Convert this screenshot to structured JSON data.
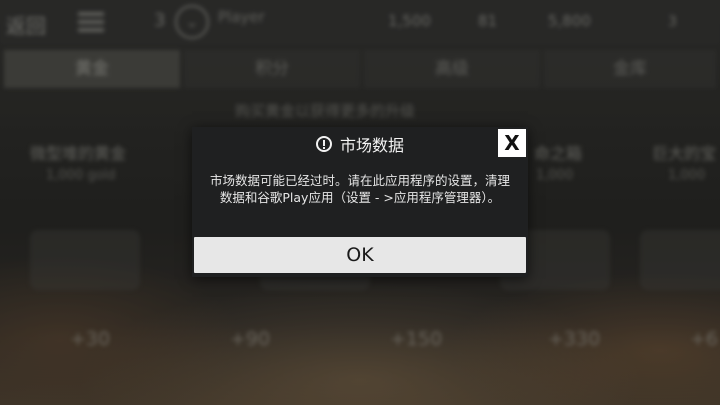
{
  "background": {
    "topbar": {
      "back_label": "返回",
      "level": "3",
      "badge_icon": "rank-badge-icon",
      "player_name": "Player",
      "stat_1": "1,500",
      "stat_2": "81",
      "stat_3": "5,800",
      "stat_4": "3"
    },
    "tabs": [
      {
        "label": "黄金"
      },
      {
        "label": "积分"
      },
      {
        "label": "高级"
      },
      {
        "label": "金库"
      }
    ],
    "subtitle": "购买黄金以获得更多的升级",
    "cards": [
      {
        "title": "微型堆的黄金",
        "price": "1,000 gold"
      },
      {
        "title": "",
        "price": ""
      },
      {
        "title": "",
        "price": ""
      },
      {
        "title": "命之箱",
        "price": "1,000"
      },
      {
        "title": "巨大的宝",
        "price": "1,000"
      }
    ],
    "rewards": [
      "+30",
      "+90",
      "+150",
      "+330",
      "+6"
    ]
  },
  "dialog": {
    "icon": "alert-circle-icon",
    "title": "市场数据",
    "close_label": "X",
    "message": "市场数据可能已经过时。请在此应用程序的设置，清理数据和谷歌Play应用（设置 - >应用程序管理器）。",
    "ok_label": "OK"
  },
  "colors": {
    "dialog_bg": "#1f2021",
    "button_bg": "#e7e7e7",
    "close_bg": "#ffffff"
  }
}
